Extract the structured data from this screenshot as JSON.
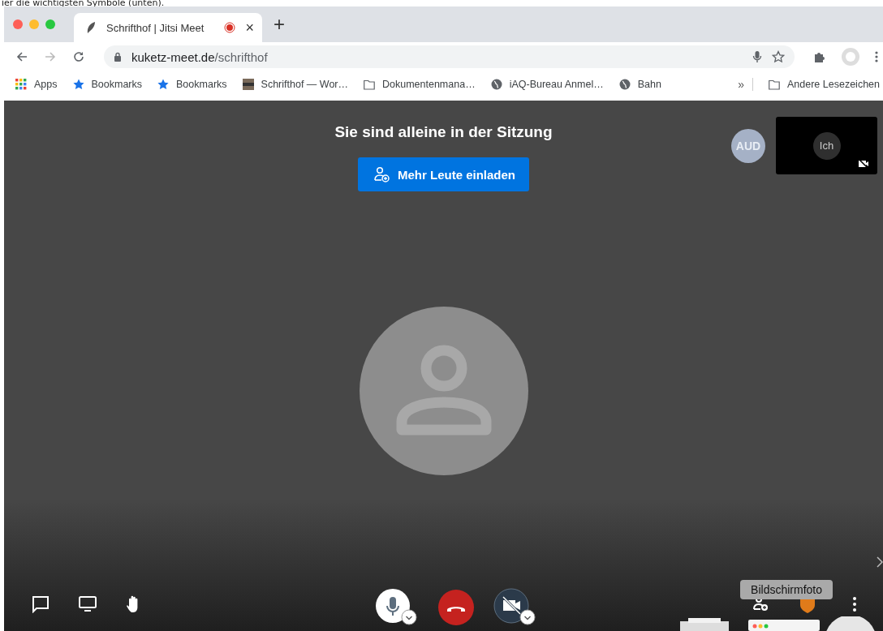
{
  "caption": "ier die wichtigsten Symbole (unten).",
  "browser": {
    "tab": {
      "title": "Schrifthof | Jitsi Meet",
      "recording": true,
      "close": "×"
    },
    "new_tab": "+",
    "address": {
      "host": "kuketz-meet.de",
      "path": "/schrifthof"
    },
    "bookmarks": [
      {
        "kind": "apps",
        "label": "Apps"
      },
      {
        "kind": "star",
        "label": "Bookmarks"
      },
      {
        "kind": "star",
        "label": "Bookmarks"
      },
      {
        "kind": "favicon",
        "label": "Schrifthof — Wor…"
      },
      {
        "kind": "folder",
        "label": "Dokumentenmana…"
      },
      {
        "kind": "globe",
        "label": "iAQ-Bureau Anmel…"
      },
      {
        "kind": "globe",
        "label": "Bahn"
      }
    ],
    "overflow": "»",
    "other_bookmarks": "Andere Lesezeichen"
  },
  "meeting": {
    "heading": "Sie sind alleine in der Sitzung",
    "invite_button": "Mehr Leute einladen",
    "thumbnail": {
      "badge": "AUD",
      "label": "Ich",
      "video_muted": true
    },
    "toolbar_left": [
      {
        "kind": "chat"
      },
      {
        "kind": "screen"
      },
      {
        "kind": "hand"
      }
    ],
    "toolbar_center": [
      {
        "kind": "mic",
        "muted": false
      },
      {
        "kind": "hangup"
      },
      {
        "kind": "camera",
        "muted": true
      }
    ],
    "toolbar_right": [
      {
        "kind": "invite"
      },
      {
        "kind": "shield"
      },
      {
        "kind": "more"
      }
    ],
    "tooltip": "Bildschirmfoto"
  }
}
